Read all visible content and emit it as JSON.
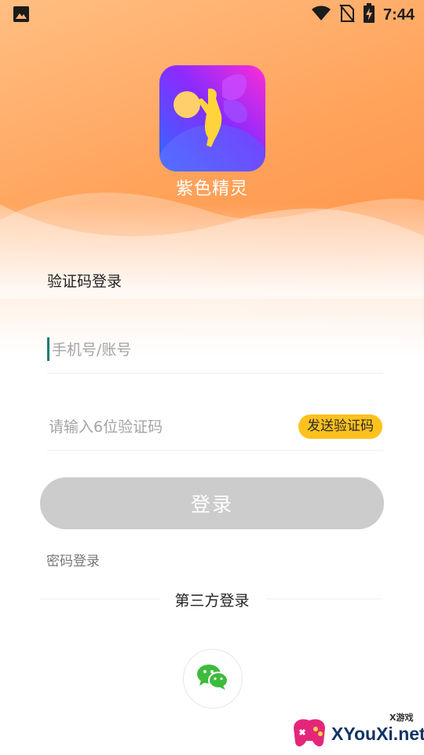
{
  "status_bar": {
    "time": "7:44",
    "icons": [
      "image-icon",
      "wifi-icon",
      "no-sim-icon",
      "battery-charging-icon"
    ]
  },
  "app": {
    "name": "紫色精灵",
    "logo": "fairy-logo"
  },
  "login": {
    "title": "验证码登录",
    "phone_placeholder": "手机号/账号",
    "code_placeholder": "请输入6位验证码",
    "send_code_label": "发送验证码",
    "submit_label": "登录",
    "password_login_label": "密码登录",
    "third_party_label": "第三方登录",
    "third_party_providers": [
      "wechat-icon"
    ]
  },
  "watermark": {
    "site": "XYouXi.net",
    "tag": "X游戏"
  },
  "colors": {
    "header_orange": "#ff9a4e",
    "accent_yellow": "#ffc11e",
    "button_disabled": "#cccccc",
    "wechat_green": "#3dbb3d"
  }
}
